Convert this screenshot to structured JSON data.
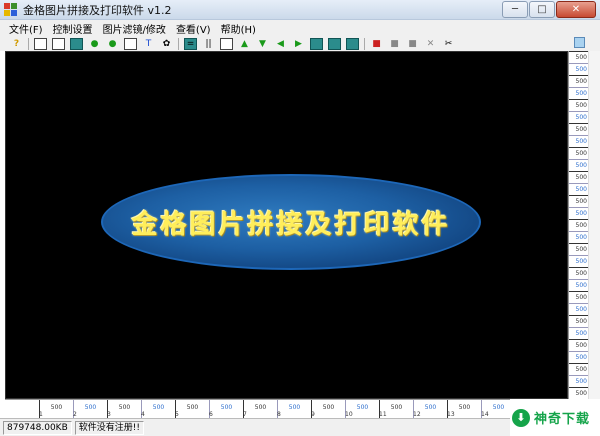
{
  "window": {
    "title": "金格图片拼接及打印软件 v1.2",
    "minimize_glyph": "─",
    "maximize_glyph": "□",
    "close_glyph": "✕"
  },
  "menu": {
    "items": [
      "文件(F)",
      "控制设置",
      "图片滤镜/修改",
      "查看(V)",
      "帮助(H)"
    ]
  },
  "toolbar": {
    "glyphs": {
      "help": "?",
      "text": "T",
      "brush": "✿",
      "eq": "=",
      "pause": "||",
      "up": "▲",
      "down": "▼",
      "left": "◀",
      "right": "▶",
      "close": "✕",
      "cut": "✂"
    }
  },
  "canvas": {
    "banner_text": "金格图片拼接及打印软件"
  },
  "vruler": {
    "labels": [
      "500",
      "500",
      "500",
      "500",
      "500",
      "500",
      "500",
      "500",
      "500",
      "500",
      "500",
      "500",
      "500",
      "500",
      "500",
      "500",
      "500",
      "500",
      "500",
      "500",
      "500",
      "500",
      "500",
      "500",
      "500",
      "500",
      "500",
      "500",
      "500"
    ]
  },
  "hruler": {
    "labels": [
      "500",
      "500",
      "500",
      "500",
      "500",
      "500",
      "500",
      "500",
      "500",
      "500",
      "500",
      "500",
      "500",
      "500"
    ],
    "numbers": [
      "1",
      "2",
      "3",
      "4",
      "5",
      "6",
      "7",
      "8",
      "9",
      "10",
      "11",
      "12",
      "13",
      "14"
    ]
  },
  "status": {
    "size": "879748.00KB",
    "registration": "软件没有注册!!"
  },
  "watermark": {
    "text": "神奇下载"
  },
  "colors": {
    "canvas_bg": "#000000",
    "banner": "#1d5fa3",
    "banner_text": "#ffee5a",
    "ruler_text": "#2b6dcc",
    "watermark": "#15a44a"
  }
}
